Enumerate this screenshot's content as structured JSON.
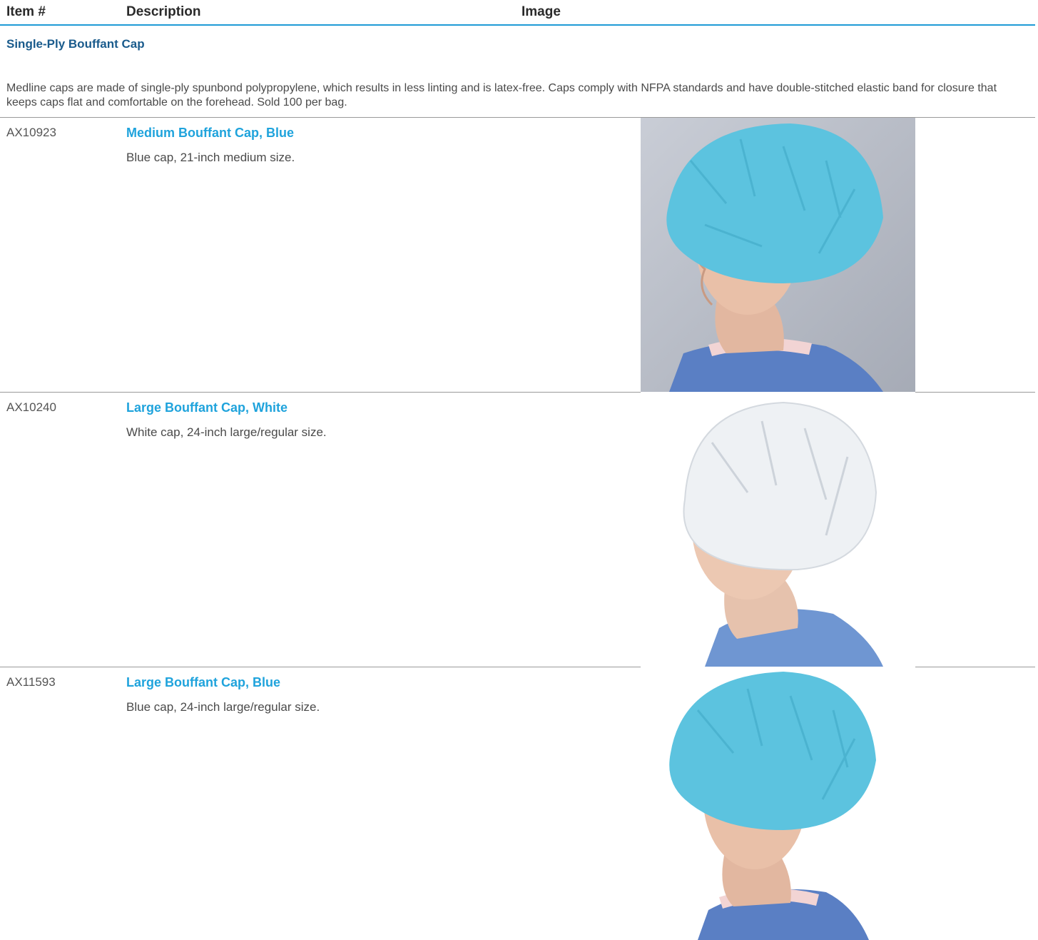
{
  "table": {
    "headers": {
      "item": "Item #",
      "description": "Description",
      "image": "Image"
    }
  },
  "section": {
    "title": "Single-Ply Bouffant Cap",
    "intro": "Medline caps are made of single-ply spunbond polypropylene, which results in less linting and is latex-free. Caps comply with NFPA standards and have double-stitched elastic band for closure that keeps caps flat and comfortable on the forehead. Sold 100 per bag."
  },
  "products": [
    {
      "item_number": "AX10923",
      "title": "Medium Bouffant Cap, Blue",
      "description": "Blue cap, 21-inch medium size."
    },
    {
      "item_number": "AX10240",
      "title": "Large Bouffant Cap, White",
      "description": "White cap, 24-inch large/regular size."
    },
    {
      "item_number": "AX11593",
      "title": "Large Bouffant Cap, Blue",
      "description": "Blue cap, 24-inch large/regular size."
    }
  ],
  "colors": {
    "header_rule": "#1f9bd6",
    "section_title": "#1a5b8c",
    "product_title": "#1fa3dc",
    "cap_blue": "#5cc3df",
    "cap_white": "#eef1f4",
    "scrubs": "#5a7fc4"
  }
}
